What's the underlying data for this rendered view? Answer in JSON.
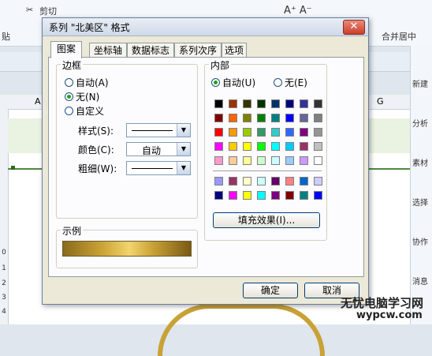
{
  "app": {
    "ribbon": {
      "cut_label": "剪切",
      "paste_label": "贴",
      "merge_label": "合并居中"
    },
    "column_headers": [
      "A",
      "G"
    ],
    "row_numbers": [
      "0",
      "1",
      "2",
      "3",
      "4"
    ],
    "sidebar_items": [
      "新建",
      "分析",
      "素材",
      "选择",
      "协作",
      "消息"
    ]
  },
  "dialog": {
    "title": "系列 \"北美区\" 格式",
    "tabs": [
      "图案",
      "坐标轴",
      "数据标志",
      "系列次序",
      "选项"
    ],
    "border": {
      "label": "边框",
      "options": [
        "自动(A)",
        "无(N)",
        "自定义"
      ],
      "selected": "无(N)",
      "style_label": "样式(S):",
      "color_label": "颜色(C):",
      "color_value": "自动",
      "weight_label": "粗细(W):"
    },
    "interior": {
      "label": "内部",
      "options": [
        "自动(U)",
        "无(E)"
      ],
      "selected": "自动(U)",
      "fill_button": "填充效果(I)..."
    },
    "sample_label": "示例",
    "ok_button": "确定",
    "cancel_button": "取消",
    "close_icon": "close-icon",
    "palette_main": [
      [
        "#000000",
        "#993300",
        "#333300",
        "#003300",
        "#003366",
        "#000080",
        "#333399",
        "#333333"
      ],
      [
        "#800000",
        "#FF6600",
        "#808000",
        "#008000",
        "#008080",
        "#0000FF",
        "#666699",
        "#808080"
      ],
      [
        "#FF0000",
        "#FF9900",
        "#99CC00",
        "#339966",
        "#33CCCC",
        "#3366FF",
        "#800080",
        "#969696"
      ],
      [
        "#FF00FF",
        "#FFCC00",
        "#FFFF00",
        "#00FF00",
        "#00FFFF",
        "#00CCFF",
        "#993366",
        "#C0C0C0"
      ],
      [
        "#FF99CC",
        "#FFCC99",
        "#FFFF99",
        "#CCFFCC",
        "#CCFFFF",
        "#99CCFF",
        "#CC99FF",
        "#FFFFFF"
      ]
    ],
    "palette_chart": [
      [
        "#9999FF",
        "#993366",
        "#FFFFCC",
        "#CCFFFF",
        "#660066",
        "#FF8080",
        "#0066CC",
        "#CCCCFF"
      ],
      [
        "#000080",
        "#FF00FF",
        "#FFFF00",
        "#00FFFF",
        "#800080",
        "#800000",
        "#008080",
        "#0000FF"
      ]
    ]
  },
  "watermark": {
    "line1": "无忧电脑学习网",
    "line2": "wypcw.com"
  }
}
